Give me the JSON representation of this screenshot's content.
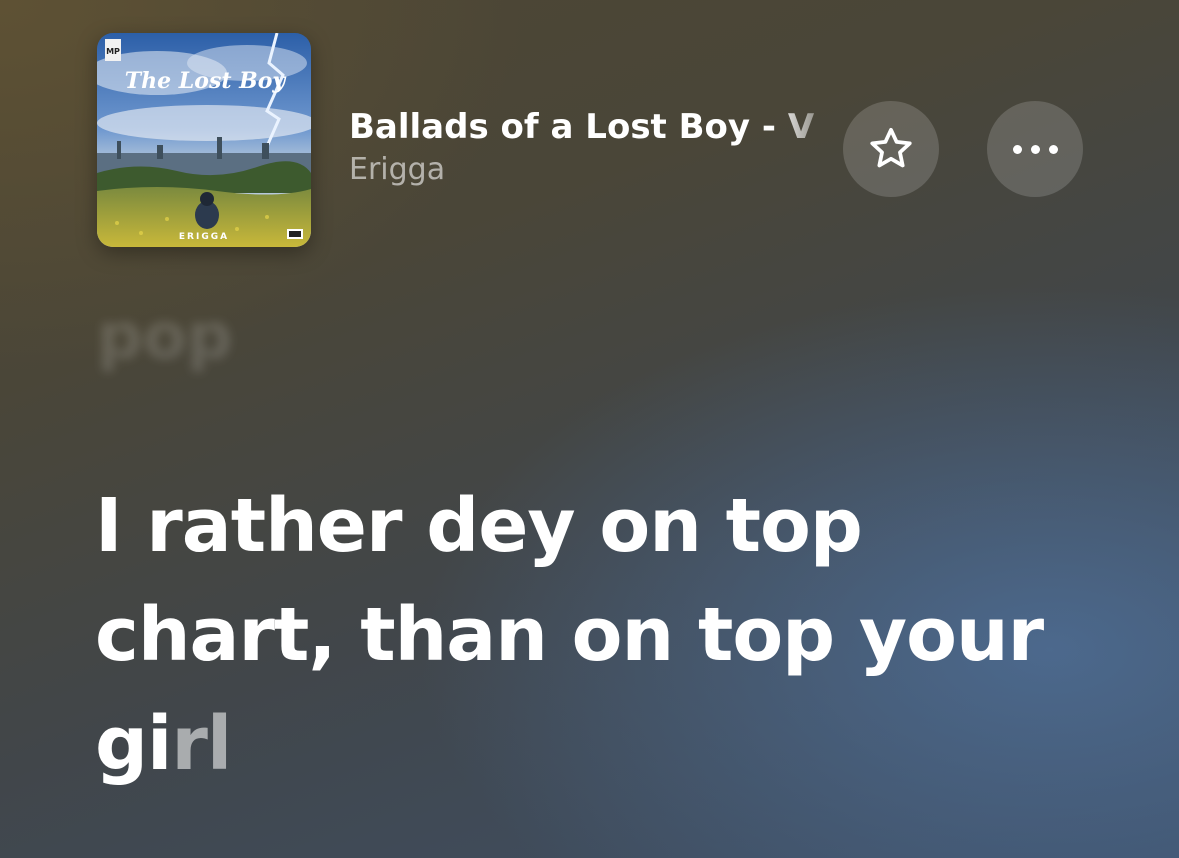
{
  "now_playing": {
    "title": "Ballads of a Lost Boy - V",
    "artist": "Erigga",
    "artwork": {
      "title_text": "The Lost Boy",
      "artist_text": "ERIGGA",
      "label_badge": "MP"
    }
  },
  "actions": {
    "favorite_icon": "star-icon",
    "more_icon": "ellipsis-icon"
  },
  "lyrics": {
    "previous_line": "pop",
    "current_line": {
      "line1": "I rather dey on top",
      "line2": "chart, than on top your",
      "line3_sung": "gi",
      "line3_pending": "rl"
    }
  },
  "colors": {
    "background_top": "#4d4634",
    "background_bottom": "#3e5068",
    "button_fill": "rgba(255,255,255,0.16)",
    "text_primary": "#ffffff",
    "text_secondary": "rgba(255,255,255,0.58)"
  }
}
